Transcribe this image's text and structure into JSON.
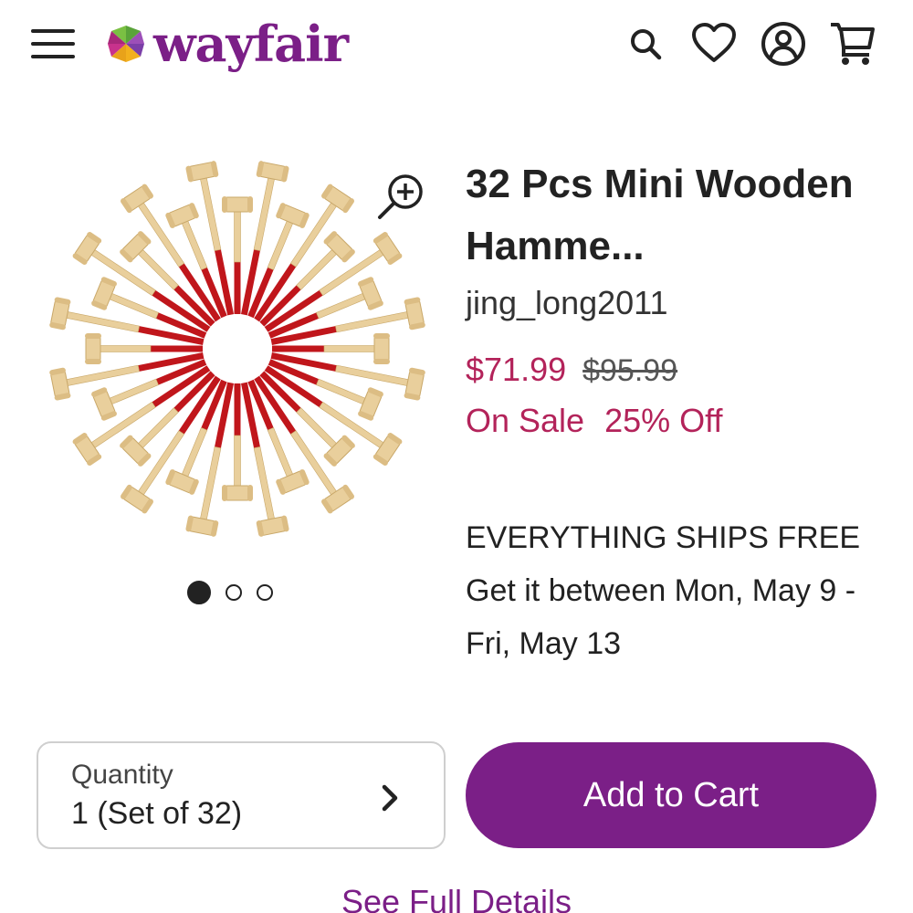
{
  "header": {
    "brand": "wayfair",
    "icons": {
      "menu": "hamburger-menu-icon",
      "search": "search-icon",
      "favorites": "heart-icon",
      "account": "account-icon",
      "cart": "cart-icon"
    }
  },
  "gallery": {
    "slide_count": 3,
    "active_slide": 1,
    "zoom_icon": "zoom-in-icon"
  },
  "product": {
    "title": "32 Pcs Mini Wooden Hamme...",
    "seller": "jing_long2011",
    "price": "$71.99",
    "original_price": "$95.99",
    "sale_label": "On Sale",
    "discount_label": "25% Off",
    "shipping_headline": "EVERYTHING SHIPS FREE",
    "delivery_text": "Get it between Mon, May 9 - Fri, May 13"
  },
  "purchase": {
    "quantity_label": "Quantity",
    "quantity_value": "1 (Set of 32)",
    "add_to_cart_label": "Add to Cart",
    "see_full_details_label": "See Full Details"
  },
  "colors": {
    "brand_purple": "#7b1f87",
    "sale_red": "#b3235a",
    "hammer_wood": "#e9cf9c",
    "hammer_red": "#c0161b"
  }
}
